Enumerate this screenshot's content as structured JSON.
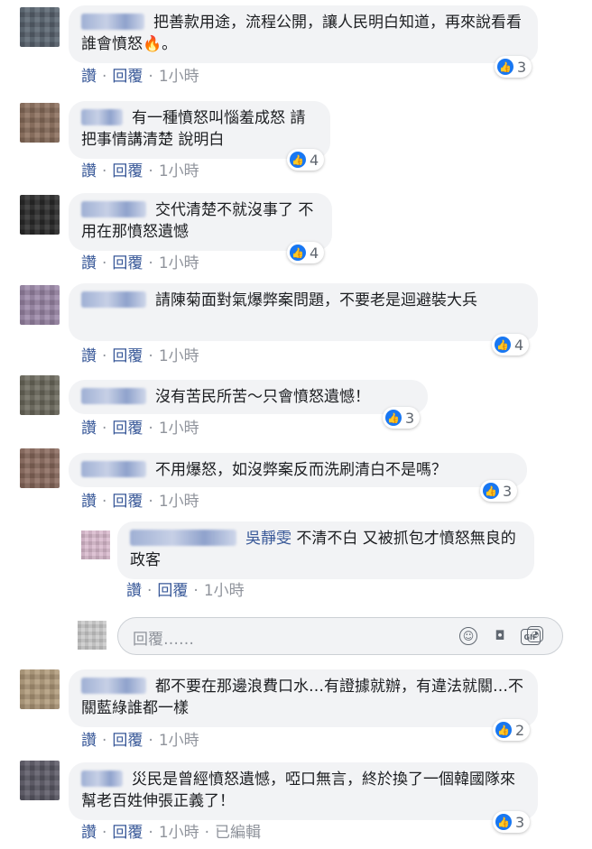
{
  "actions": {
    "like": "讚",
    "reply": "回覆",
    "dot": "·",
    "edited": "已編輯"
  },
  "comments": [
    {
      "text": "把善款用途，流程公開，讓人民明白知道，再來說看看誰會憤怒🔥。",
      "time": "1小時",
      "likes": "3",
      "avatar_color": "#5a6470"
    },
    {
      "text": "有一種憤怒叫惱羞成怒 請把事情講清楚 說明白",
      "time": "1小時",
      "likes": "4",
      "avatar_color": "#8a6e5c"
    },
    {
      "text": "交代清楚不就沒事了 不用在那憤怒遺憾",
      "time": "1小時",
      "likes": "4",
      "avatar_color": "#2a2a2a"
    },
    {
      "text": "請陳菊面對氣爆弊案問題，不要老是迴避裝大兵",
      "time": "1小時",
      "likes": "4",
      "avatar_color": "#9c88a8"
    },
    {
      "text": "沒有苦民所苦～只會憤怒遺憾！",
      "time": "1小時",
      "likes": "3",
      "avatar_color": "#6d6a5e"
    },
    {
      "text": "不用爆怒，如沒弊案反而洗刷清白不是嗎？",
      "time": "1小時",
      "likes": "3",
      "avatar_color": "#8a6a5e"
    },
    {
      "text": "都不要在那邊浪費口水…有證據就辦，有違法就關…不關藍綠誰都一樣",
      "time": "1小時",
      "likes": "2",
      "avatar_color": "#b09a7a"
    },
    {
      "text": "災民是曾經憤怒遺憾，啞口無言，終於換了一個韓國隊來幫老百姓伸張正義了！",
      "time": "1小時",
      "likes": "3",
      "avatar_color": "#5c5a66"
    }
  ],
  "reply": {
    "mention": "吳靜雯",
    "text": " 不清不白 又被抓包才憤怒無良的政客",
    "time": "1小時"
  },
  "reply_box": {
    "placeholder": "回覆……",
    "icons": [
      "emoji-icon",
      "camera-icon",
      "gif-icon",
      "sticker-icon"
    ]
  },
  "colors": {
    "link": "#385898",
    "bubble": "#f2f3f5",
    "like": "#1877f2"
  }
}
